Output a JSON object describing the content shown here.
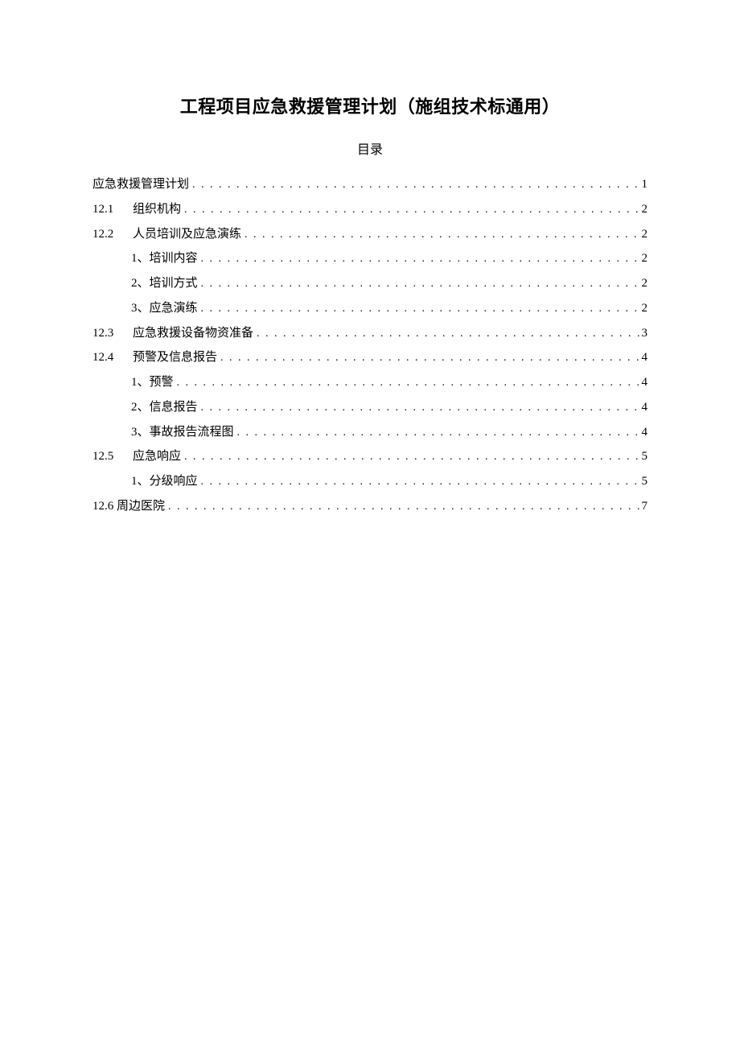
{
  "document": {
    "title": "工程项目应急救援管理计划（施组技术标通用）",
    "toc_heading": "目录",
    "toc": [
      {
        "level": 0,
        "num": "",
        "title": "应急救援管理计划",
        "page": "1"
      },
      {
        "level": 0,
        "num": "12.1",
        "title": "组织机构",
        "page": "2"
      },
      {
        "level": 0,
        "num": "12.2",
        "title": "人员培训及应急演练",
        "page": "2"
      },
      {
        "level": 1,
        "num": "",
        "title": "1、培训内容",
        "page": "2"
      },
      {
        "level": 1,
        "num": "",
        "title": "2、培训方式",
        "page": "2"
      },
      {
        "level": 1,
        "num": "",
        "title": "3、应急演练",
        "page": "2"
      },
      {
        "level": 0,
        "num": "12.3",
        "title": "应急救援设备物资准备",
        "page": "3"
      },
      {
        "level": 0,
        "num": "12.4",
        "title": "预警及信息报告",
        "page": "4"
      },
      {
        "level": 1,
        "num": "",
        "title": "1、预警",
        "page": "4"
      },
      {
        "level": 1,
        "num": "",
        "title": "2、信息报告",
        "page": "4"
      },
      {
        "level": 1,
        "num": "",
        "title": "3、事故报告流程图",
        "page": "4"
      },
      {
        "level": 0,
        "num": "12.5",
        "title": "应急响应",
        "page": "5"
      },
      {
        "level": 1,
        "num": "",
        "title": "1、分级响应",
        "page": "5"
      },
      {
        "level": 0,
        "num": "12.6",
        "title": "周边医院",
        "page": "7",
        "tight": true
      }
    ]
  }
}
